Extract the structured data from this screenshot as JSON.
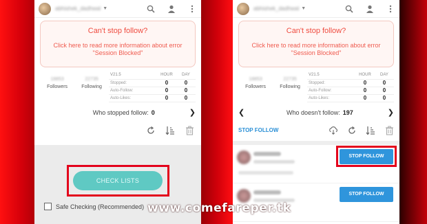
{
  "colors": {
    "alert_text": "#ef4b3f",
    "check_button": "#5fc9c3",
    "stop_button": "#2f95dc",
    "highlight": "#e3001b",
    "background": "#c4000a"
  },
  "left": {
    "username": "abhishek_dadhwal",
    "alert": {
      "title": "Can't stop follow?",
      "line1": "Click here to read more information about error",
      "line2": "\"Session Blocked\""
    },
    "followers": {
      "value": "18853",
      "label": "Followers"
    },
    "following": {
      "value": "22735",
      "label": "Following"
    },
    "table": {
      "version": "V21.5",
      "hour": "HOUR",
      "day": "DAY",
      "rows": [
        {
          "label": "Stopped:",
          "hour": "0",
          "day": "0"
        },
        {
          "label": "Auto-Follow:",
          "hour": "0",
          "day": "0"
        },
        {
          "label": "Auto-Likes:",
          "hour": "0",
          "day": "0"
        }
      ]
    },
    "who": {
      "label": "Who stopped follow:",
      "value": "0"
    },
    "check_button": "CHECK LISTS",
    "safe_checking": "Safe Checking (Recommended)"
  },
  "right": {
    "username": "abhishek_dadhwal",
    "alert": {
      "title": "Can't stop follow?",
      "line1": "Click here to read more information about error",
      "line2": "\"Session Blocked\""
    },
    "followers": {
      "value": "18853",
      "label": "Followers"
    },
    "following": {
      "value": "22735",
      "label": "Following"
    },
    "table": {
      "version": "V21.5",
      "hour": "HOUR",
      "day": "DAY",
      "rows": [
        {
          "label": "Stopped:",
          "hour": "0",
          "day": "0"
        },
        {
          "label": "Auto-Follow:",
          "hour": "0",
          "day": "0"
        },
        {
          "label": "Auto-Likes:",
          "hour": "0",
          "day": "0"
        }
      ]
    },
    "who": {
      "label": "Who doesn't follow:",
      "value": "197"
    },
    "stop_follow_link": "STOP FOLLOW",
    "stop_follow_button": "STOP FOLLOW"
  },
  "watermark": "www.comefareper.tk"
}
